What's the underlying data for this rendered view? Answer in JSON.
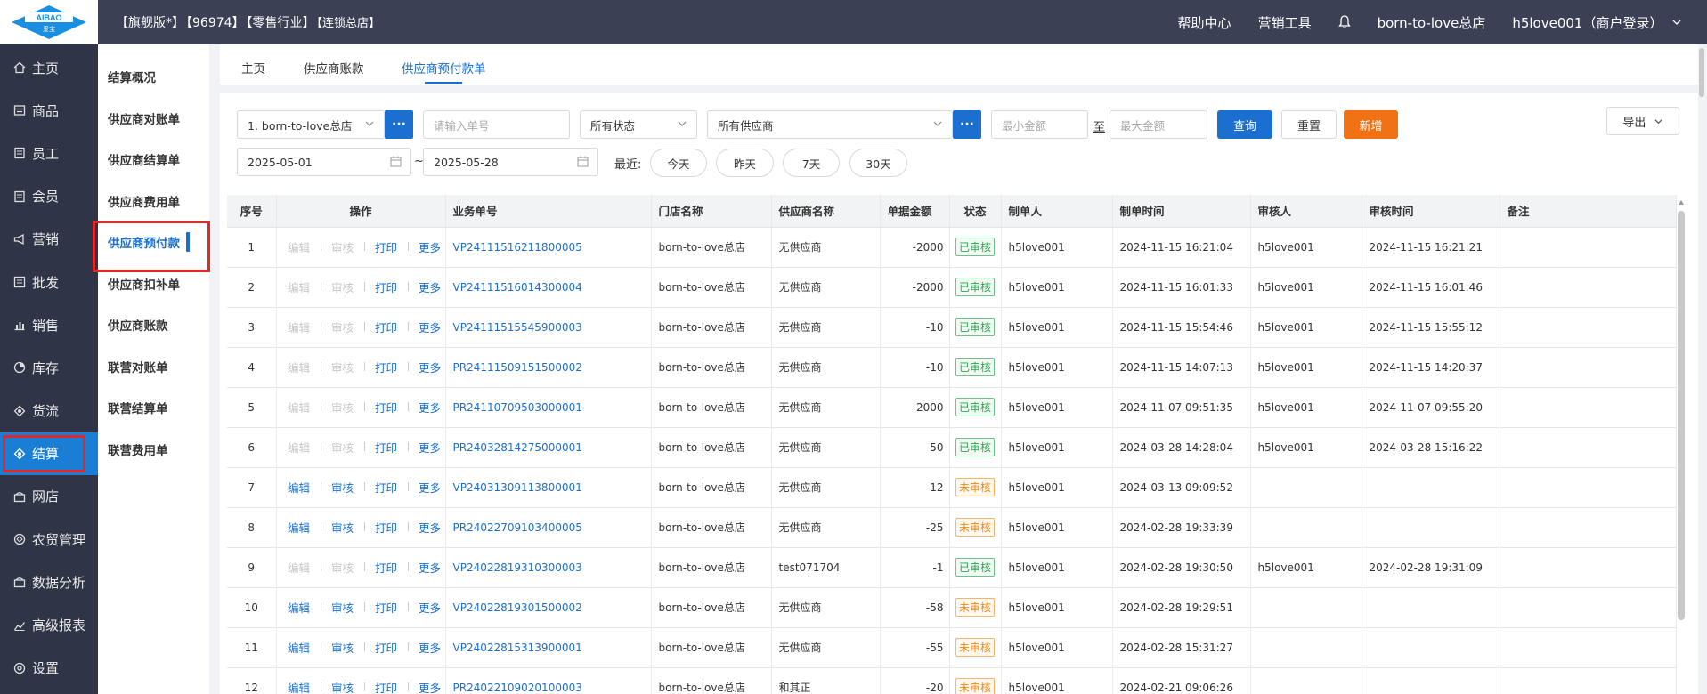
{
  "header": {
    "logo_text_top": "AIBAO",
    "logo_text_bottom": "爱宝",
    "shop_edition": "【旗舰版*】",
    "shop_id": "【96974】",
    "shop_industry": "【零售行业】",
    "shop_type": "【连锁总店】",
    "help": "帮助中心",
    "marketing_tools": "营销工具",
    "store_name": "born-to-love总店",
    "user": "h5love001（商户登录）"
  },
  "sidebar": {
    "items": [
      {
        "label": "主页",
        "icon": "home-icon"
      },
      {
        "label": "商品",
        "icon": "goods-icon"
      },
      {
        "label": "员工",
        "icon": "staff-icon"
      },
      {
        "label": "会员",
        "icon": "member-icon"
      },
      {
        "label": "营销",
        "icon": "megaphone-icon"
      },
      {
        "label": "批发",
        "icon": "wholesale-icon"
      },
      {
        "label": "销售",
        "icon": "chart-icon"
      },
      {
        "label": "库存",
        "icon": "inventory-icon"
      },
      {
        "label": "货流",
        "icon": "flow-icon"
      },
      {
        "label": "结算",
        "icon": "settle-icon"
      },
      {
        "label": "网店",
        "icon": "shop-icon"
      },
      {
        "label": "农贸管理",
        "icon": "farm-icon"
      },
      {
        "label": "数据分析",
        "icon": "data-icon"
      },
      {
        "label": "高级报表",
        "icon": "report-icon"
      },
      {
        "label": "设置",
        "icon": "gear-icon"
      }
    ],
    "active_index": 9
  },
  "submenu": {
    "items": [
      "结算概况",
      "供应商对账单",
      "供应商结算单",
      "供应商费用单",
      "供应商预付款",
      "供应商扣补单",
      "供应商账款",
      "联营对账单",
      "联营结算单",
      "联营费用单"
    ],
    "active_index": 4
  },
  "tabs": [
    "主页",
    "供应商账款",
    "供应商预付款单"
  ],
  "filters": {
    "store": "1. born-to-love总店",
    "order_placeholder": "请输入单号",
    "status": "所有状态",
    "supplier": "所有供应商",
    "min_placeholder": "最小金额",
    "to": "至",
    "max_placeholder": "最大金额",
    "query": "查询",
    "reset": "重置",
    "add": "新增",
    "export": "导出",
    "date_from": "2025-05-01",
    "date_sep": "~",
    "date_to": "2025-05-28",
    "recent": "最近:",
    "quick": [
      "今天",
      "昨天",
      "7天",
      "30天"
    ],
    "more_dots": "···"
  },
  "table": {
    "columns": [
      "序号",
      "操作",
      "业务单号",
      "门店名称",
      "供应商名称",
      "单据金额",
      "状态",
      "制单人",
      "制单时间",
      "审核人",
      "审核时间",
      "备注"
    ],
    "ops": [
      "编辑",
      "审核",
      "打印",
      "更多"
    ],
    "rows": [
      {
        "no": "1",
        "editable": false,
        "order": "VP24111516211800005",
        "store": "born-to-love总店",
        "supplier": "无供应商",
        "amount": "-2000",
        "status": "已审核",
        "ok": true,
        "maker": "h5love001",
        "make_time": "2024-11-15 16:21:04",
        "auditor": "h5love001",
        "audit_time": "2024-11-15 16:21:21",
        "remark": ""
      },
      {
        "no": "2",
        "editable": false,
        "order": "VP24111516014300004",
        "store": "born-to-love总店",
        "supplier": "无供应商",
        "amount": "-2000",
        "status": "已审核",
        "ok": true,
        "maker": "h5love001",
        "make_time": "2024-11-15 16:01:33",
        "auditor": "h5love001",
        "audit_time": "2024-11-15 16:01:46",
        "remark": ""
      },
      {
        "no": "3",
        "editable": false,
        "order": "VP24111515545900003",
        "store": "born-to-love总店",
        "supplier": "无供应商",
        "amount": "-10",
        "status": "已审核",
        "ok": true,
        "maker": "h5love001",
        "make_time": "2024-11-15 15:54:46",
        "auditor": "h5love001",
        "audit_time": "2024-11-15 15:55:12",
        "remark": ""
      },
      {
        "no": "4",
        "editable": false,
        "order": "PR24111509151500002",
        "store": "born-to-love总店",
        "supplier": "无供应商",
        "amount": "-10",
        "status": "已审核",
        "ok": true,
        "maker": "h5love001",
        "make_time": "2024-11-15 14:07:13",
        "auditor": "h5love001",
        "audit_time": "2024-11-15 14:20:37",
        "remark": ""
      },
      {
        "no": "5",
        "editable": false,
        "order": "PR24110709503000001",
        "store": "born-to-love总店",
        "supplier": "无供应商",
        "amount": "-2000",
        "status": "已审核",
        "ok": true,
        "maker": "h5love001",
        "make_time": "2024-11-07 09:51:35",
        "auditor": "h5love001",
        "audit_time": "2024-11-07 09:55:20",
        "remark": ""
      },
      {
        "no": "6",
        "editable": false,
        "order": "PR24032814275000001",
        "store": "born-to-love总店",
        "supplier": "无供应商",
        "amount": "-50",
        "status": "已审核",
        "ok": true,
        "maker": "h5love001",
        "make_time": "2024-03-28 14:28:04",
        "auditor": "h5love001",
        "audit_time": "2024-03-28 15:16:22",
        "remark": ""
      },
      {
        "no": "7",
        "editable": true,
        "order": "VP24031309113800001",
        "store": "born-to-love总店",
        "supplier": "无供应商",
        "amount": "-12",
        "status": "未审核",
        "ok": false,
        "maker": "h5love001",
        "make_time": "2024-03-13 09:09:52",
        "auditor": "",
        "audit_time": "",
        "remark": ""
      },
      {
        "no": "8",
        "editable": true,
        "order": "PR24022709103400005",
        "store": "born-to-love总店",
        "supplier": "无供应商",
        "amount": "-25",
        "status": "未审核",
        "ok": false,
        "maker": "h5love001",
        "make_time": "2024-02-28 19:33:39",
        "auditor": "",
        "audit_time": "",
        "remark": ""
      },
      {
        "no": "9",
        "editable": false,
        "order": "VP24022819310300003",
        "store": "born-to-love总店",
        "supplier": "test071704",
        "amount": "-1",
        "status": "已审核",
        "ok": true,
        "maker": "h5love001",
        "make_time": "2024-02-28 19:30:50",
        "auditor": "h5love001",
        "audit_time": "2024-02-28 19:31:09",
        "remark": ""
      },
      {
        "no": "10",
        "editable": true,
        "order": "VP24022819301500002",
        "store": "born-to-love总店",
        "supplier": "无供应商",
        "amount": "-58",
        "status": "未审核",
        "ok": false,
        "maker": "h5love001",
        "make_time": "2024-02-28 19:29:51",
        "auditor": "",
        "audit_time": "",
        "remark": ""
      },
      {
        "no": "11",
        "editable": true,
        "order": "VP24022815313900001",
        "store": "born-to-love总店",
        "supplier": "无供应商",
        "amount": "-55",
        "status": "未审核",
        "ok": false,
        "maker": "h5love001",
        "make_time": "2024-02-28 15:31:27",
        "auditor": "",
        "audit_time": "",
        "remark": ""
      },
      {
        "no": "12",
        "editable": true,
        "order": "PR24022109020100003",
        "store": "born-to-love总店",
        "supplier": "和其正",
        "amount": "-20",
        "status": "未审核",
        "ok": false,
        "maker": "h5love001",
        "make_time": "2024-02-21 09:06:26",
        "auditor": "",
        "audit_time": "",
        "remark": ""
      }
    ]
  }
}
